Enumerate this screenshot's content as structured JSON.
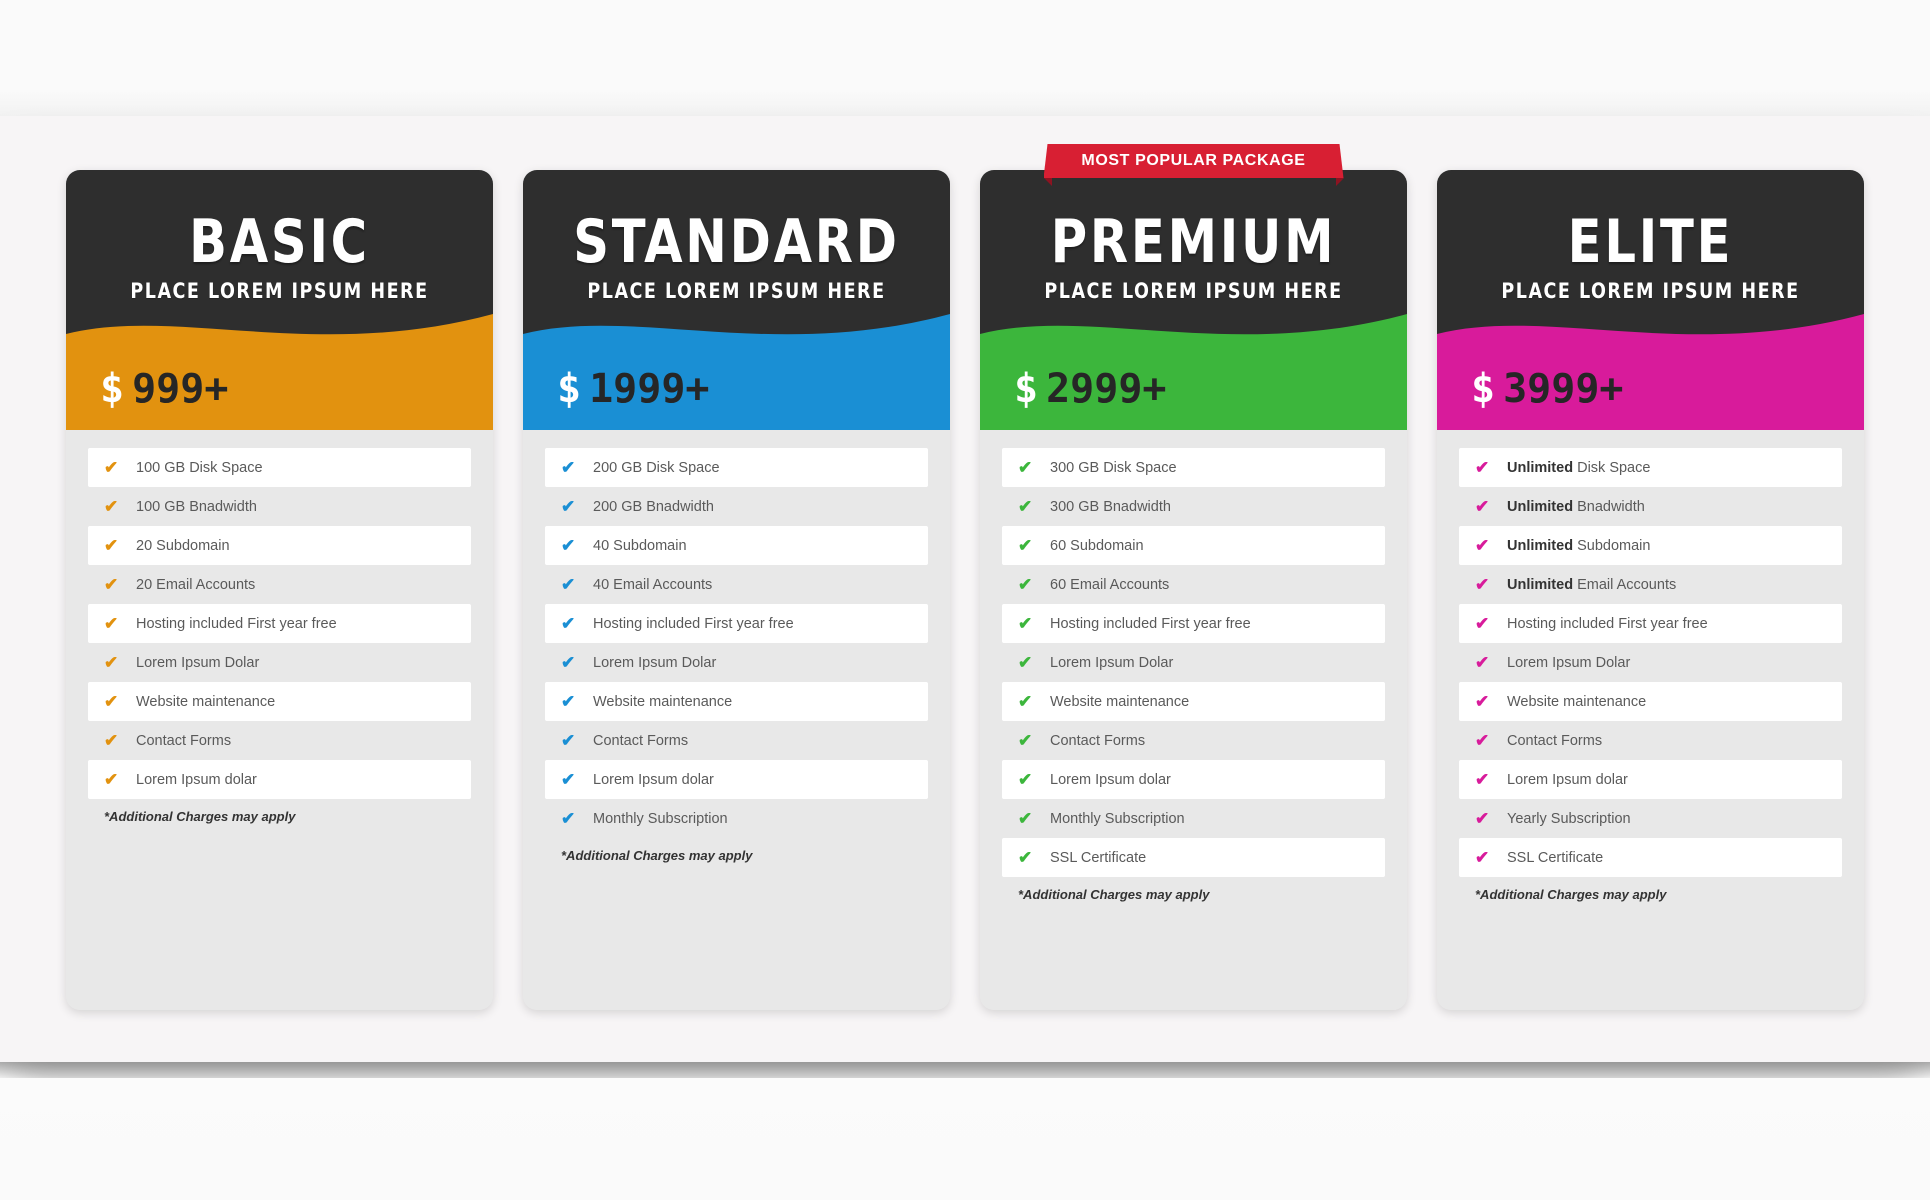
{
  "page": {
    "background": "#fafafa",
    "panel_background": "#f7f5f6"
  },
  "ribbon": {
    "label": "MOST POPULAR PACKAGE",
    "color": "#d81f33",
    "shown_on_plan_index": 2
  },
  "note_text": "*Additional Charges may apply",
  "plans": [
    {
      "name": "BASIC",
      "subtitle": "PLACE LOREM IPSUM HERE",
      "currency": "$",
      "price": "999+",
      "accent": "#e2920f",
      "header_bg": "#2e2e2e",
      "features": [
        {
          "bold": "",
          "text": "100 GB Disk Space"
        },
        {
          "bold": "",
          "text": "100 GB Bnadwidth"
        },
        {
          "bold": "",
          "text": "20 Subdomain"
        },
        {
          "bold": "",
          "text": "20 Email Accounts"
        },
        {
          "bold": "",
          "text": "Hosting included First year free"
        },
        {
          "bold": "",
          "text": "Lorem Ipsum Dolar"
        },
        {
          "bold": "",
          "text": "Website maintenance"
        },
        {
          "bold": "",
          "text": "Contact Forms"
        },
        {
          "bold": "",
          "text": "Lorem Ipsum dolar"
        }
      ]
    },
    {
      "name": "STANDARD",
      "subtitle": "PLACE LOREM IPSUM HERE",
      "currency": "$",
      "price": "1999+",
      "accent": "#1a8fd4",
      "header_bg": "#2e2e2e",
      "features": [
        {
          "bold": "",
          "text": "200 GB Disk Space"
        },
        {
          "bold": "",
          "text": "200 GB Bnadwidth"
        },
        {
          "bold": "",
          "text": "40 Subdomain"
        },
        {
          "bold": "",
          "text": "40 Email Accounts"
        },
        {
          "bold": "",
          "text": "Hosting included First year free"
        },
        {
          "bold": "",
          "text": "Lorem Ipsum Dolar"
        },
        {
          "bold": "",
          "text": "Website maintenance"
        },
        {
          "bold": "",
          "text": "Contact Forms"
        },
        {
          "bold": "",
          "text": "Lorem Ipsum dolar"
        },
        {
          "bold": "",
          "text": "Monthly Subscription"
        }
      ]
    },
    {
      "name": "PREMIUM",
      "subtitle": "PLACE LOREM IPSUM HERE",
      "currency": "$",
      "price": "2999+",
      "accent": "#3cb63c",
      "header_bg": "#2e2e2e",
      "features": [
        {
          "bold": "",
          "text": "300 GB Disk Space"
        },
        {
          "bold": "",
          "text": "300 GB Bnadwidth"
        },
        {
          "bold": "",
          "text": "60 Subdomain"
        },
        {
          "bold": "",
          "text": "60 Email Accounts"
        },
        {
          "bold": "",
          "text": "Hosting included First year free"
        },
        {
          "bold": "",
          "text": "Lorem Ipsum Dolar"
        },
        {
          "bold": "",
          "text": "Website maintenance"
        },
        {
          "bold": "",
          "text": "Contact Forms"
        },
        {
          "bold": "",
          "text": "Lorem Ipsum dolar"
        },
        {
          "bold": "",
          "text": "Monthly Subscription"
        },
        {
          "bold": "",
          "text": "SSL Certificate"
        }
      ]
    },
    {
      "name": "ELITE",
      "subtitle": "PLACE LOREM IPSUM HERE",
      "currency": "$",
      "price": "3999+",
      "accent": "#d81b9b",
      "header_bg": "#2e2e2e",
      "features": [
        {
          "bold": "Unlimited",
          "text": " Disk Space"
        },
        {
          "bold": "Unlimited",
          "text": " Bnadwidth"
        },
        {
          "bold": "Unlimited",
          "text": " Subdomain"
        },
        {
          "bold": "Unlimited",
          "text": " Email Accounts"
        },
        {
          "bold": "",
          "text": "Hosting included First year free"
        },
        {
          "bold": "",
          "text": "Lorem Ipsum Dolar"
        },
        {
          "bold": "",
          "text": "Website maintenance"
        },
        {
          "bold": "",
          "text": "Contact Forms"
        },
        {
          "bold": "",
          "text": "Lorem Ipsum dolar"
        },
        {
          "bold": "",
          "text": "Yearly Subscription"
        },
        {
          "bold": "",
          "text": "SSL Certificate"
        }
      ]
    }
  ]
}
